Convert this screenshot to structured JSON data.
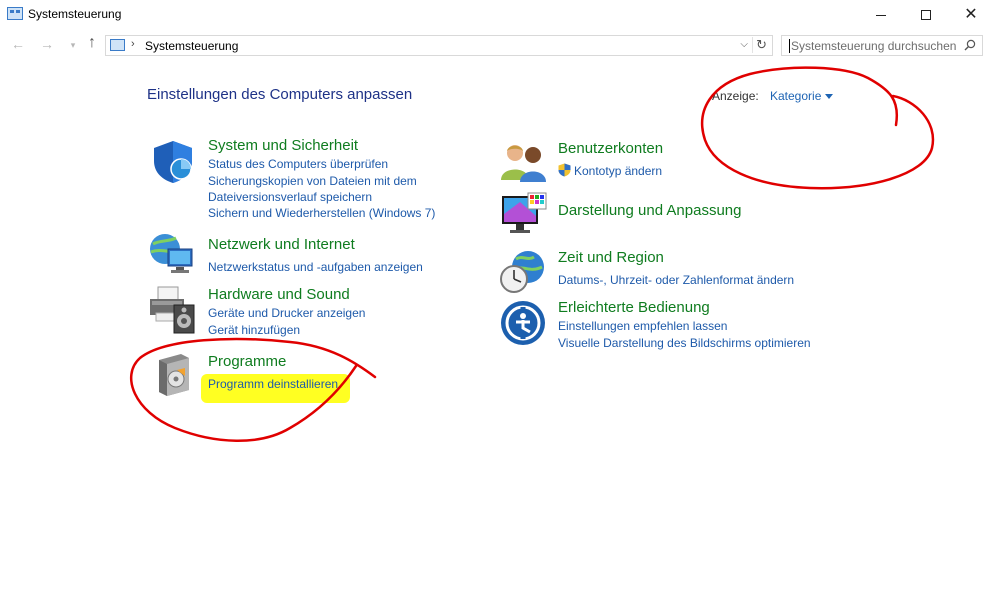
{
  "window": {
    "title": "Systemsteuerung",
    "icon": "control-panel-icon"
  },
  "address": {
    "path": "Systemsteuerung",
    "search_placeholder": "Systemsteuerung durchsuchen"
  },
  "header": {
    "title": "Einstellungen des Computers anpassen",
    "view_label": "Anzeige:",
    "view_value": "Kategorie"
  },
  "categories": [
    {
      "title": "System und Sicherheit",
      "icon": "shield-icon",
      "links": [
        "Status des Computers überprüfen",
        "Sicherungskopien von Dateien mit dem",
        "Dateiversionsverlauf speichern",
        "Sichern und Wiederherstellen (Windows 7)"
      ]
    },
    {
      "title": "Netzwerk und Internet",
      "icon": "network-icon",
      "links": [
        "Netzwerkstatus und -aufgaben anzeigen"
      ]
    },
    {
      "title": "Hardware und Sound",
      "icon": "printer-icon",
      "links": [
        "Geräte und Drucker anzeigen",
        "Gerät hinzufügen"
      ]
    },
    {
      "title": "Programme",
      "icon": "programs-icon",
      "links": [
        "Programm deinstallieren"
      ]
    },
    {
      "title": "Benutzerkonten",
      "icon": "users-icon",
      "links": [
        "Kontotyp ändern"
      ]
    },
    {
      "title": "Darstellung und Anpassung",
      "icon": "display-icon",
      "links": []
    },
    {
      "title": "Zeit und Region",
      "icon": "clock-globe-icon",
      "links": [
        "Datums-, Uhrzeit- oder Zahlenformat ändern"
      ]
    },
    {
      "title": "Erleichterte Bedienung",
      "icon": "accessibility-icon",
      "links": [
        "Einstellungen empfehlen lassen",
        "Visuelle Darstellung des Bildschirms optimieren"
      ]
    }
  ],
  "colors": {
    "category_title": "#0f7c1f",
    "link": "#1e5aaa",
    "header_title": "#1e3287",
    "annotation": "#e00000",
    "highlight": "#ffff22"
  }
}
